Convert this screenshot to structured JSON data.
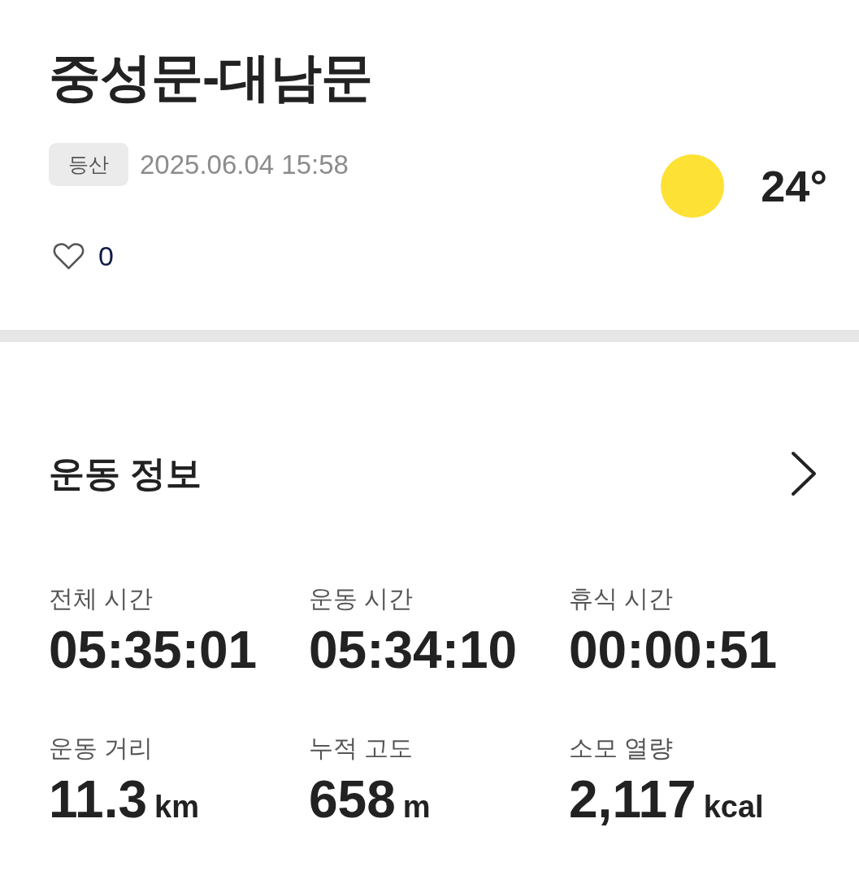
{
  "header": {
    "title": "중성문-대남문",
    "tag": "등산",
    "datetime": "2025.06.04 15:58",
    "weather": {
      "kind": "sunny",
      "temperature": "24°"
    },
    "like": {
      "liked": false,
      "count": "0"
    }
  },
  "section": {
    "title": "운동 정보"
  },
  "stats": [
    {
      "label": "전체 시간",
      "value": "05:35:01"
    },
    {
      "label": "운동 시간",
      "value": "05:34:10"
    },
    {
      "label": "휴식 시간",
      "value": "00:00:51"
    },
    {
      "label": "운동 거리",
      "value": "11.3",
      "unit": "km"
    },
    {
      "label": "누적 고도",
      "value": "658",
      "unit": "m"
    },
    {
      "label": "소모 열량",
      "value": "2,117",
      "unit": "kcal"
    }
  ]
}
